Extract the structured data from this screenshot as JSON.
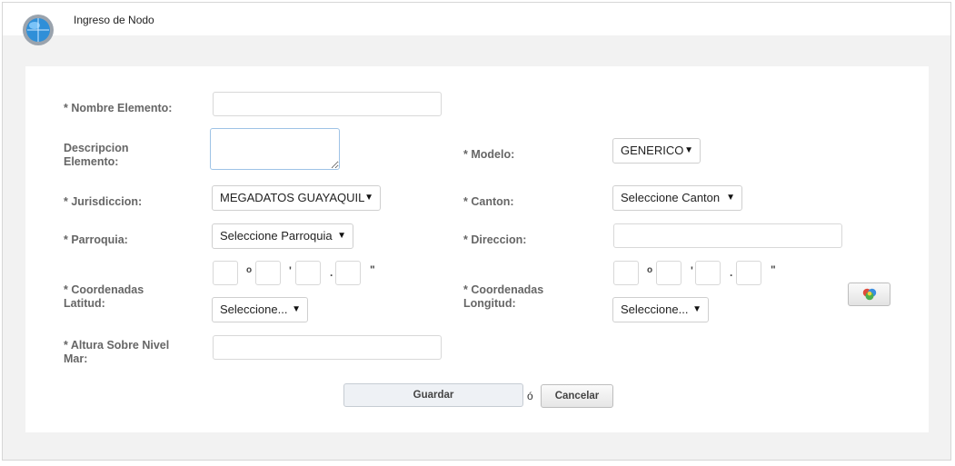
{
  "header": {
    "title": "Ingreso de Nodo",
    "icon": "globe-gear-icon"
  },
  "form": {
    "nombre_label": "* Nombre Elemento:",
    "nombre_value": "",
    "descripcion_label": "Descripcion Elemento:",
    "descripcion_value": "",
    "modelo_label": "* Modelo:",
    "modelo_value": "GENERICO",
    "jurisdiccion_label": "* Jurisdiccion:",
    "jurisdiccion_value": "MEGADATOS GUAYAQUIL",
    "canton_label": "* Canton:",
    "canton_value": "Seleccione Canton",
    "parroquia_label": "* Parroquia:",
    "parroquia_value": "Seleccione Parroquia",
    "direccion_label": "* Direccion:",
    "direccion_value": "",
    "lat_label": "* Coordenadas Latitud:",
    "lat_hemisphere": "Seleccione...",
    "lon_label": "* Coordenadas Longitud:",
    "lon_hemisphere": "Seleccione...",
    "deg_symbol": "o",
    "min_symbol": "'",
    "dec_symbol": ".",
    "sec_symbol": "\"",
    "altura_label": "* Altura Sobre Nivel Mar:",
    "altura_value": ""
  },
  "actions": {
    "save_label": "Guardar",
    "or_text": "ó",
    "cancel_label": "Cancelar",
    "map_icon": "map-pin-icon"
  },
  "colors": {
    "label": "#666666",
    "panel_bg": "#ffffff",
    "page_bg": "#f2f2f2"
  }
}
